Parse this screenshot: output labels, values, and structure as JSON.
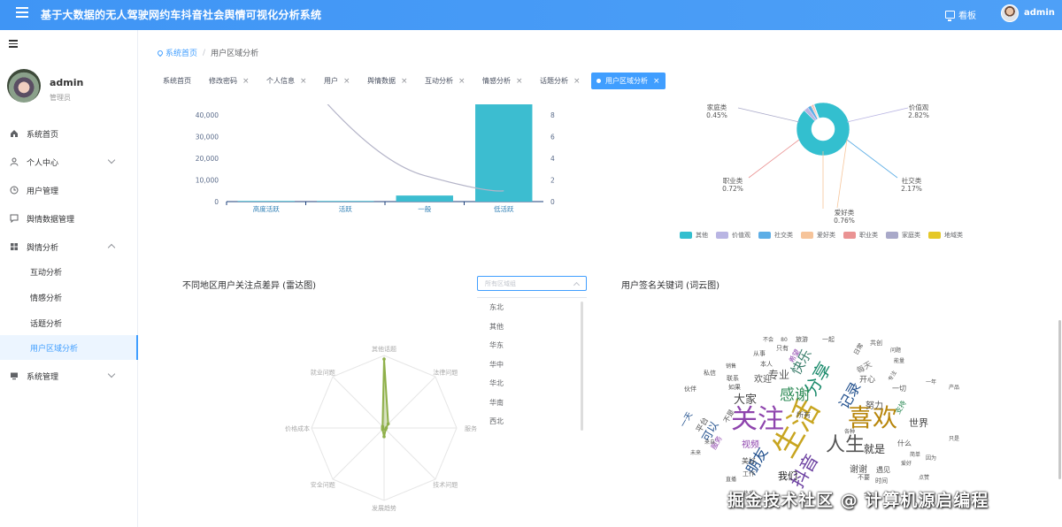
{
  "header": {
    "title": "基于大数据的无人驾驶网约车抖音社会舆情可视化分析系统",
    "board_label": "看板",
    "username": "admin"
  },
  "sidebar": {
    "user": {
      "name": "admin",
      "role": "管理员"
    },
    "items": [
      {
        "label": "系统首页",
        "icon": "home-icon"
      },
      {
        "label": "个人中心",
        "icon": "user-icon",
        "expandable": true
      },
      {
        "label": "用户管理",
        "icon": "clock-icon"
      },
      {
        "label": "舆情数据管理",
        "icon": "chat-icon"
      },
      {
        "label": "舆情分析",
        "icon": "grid-icon",
        "expanded": true,
        "children": [
          "互动分析",
          "情感分析",
          "话题分析",
          "用户区域分析"
        ]
      },
      {
        "label": "系统管理",
        "icon": "monitor-icon",
        "expandable": true
      }
    ],
    "active_child": "用户区域分析"
  },
  "breadcrumb": {
    "home": "系统首页",
    "current": "用户区域分析"
  },
  "tabs": [
    "系统首页",
    "修改密码",
    "个人信息",
    "用户",
    "舆情数据",
    "互动分析",
    "情感分析",
    "话题分析",
    "用户区域分析"
  ],
  "active_tab": "用户区域分析",
  "panels": {
    "radar_title": "不同地区用户关注点差异 (雷达图)",
    "region_select_placeholder": "所有区域组",
    "region_options": [
      "东北",
      "其他",
      "华东",
      "华中",
      "华北",
      "华南",
      "西北",
      "西南"
    ],
    "wordcloud_title": "用户签名关键词 (词云图)"
  },
  "chart_data": [
    {
      "type": "bar",
      "categories": [
        "高度活跃",
        "活跃",
        "一般",
        "低活跃"
      ],
      "series": [
        {
          "type": "bar",
          "values": [
            300,
            300,
            2800,
            45000
          ],
          "color": "#3cbdd0"
        },
        {
          "type": "line",
          "values": [
            16,
            10,
            4,
            1
          ],
          "axis": "right",
          "color": "#b4b4c8"
        }
      ],
      "ylim": [
        0,
        40000
      ],
      "yticks": [
        "0",
        "10,000",
        "20,000",
        "30,000",
        "40,000"
      ],
      "y2ticks": [
        "0",
        "2",
        "4",
        "6",
        "8"
      ]
    },
    {
      "type": "pie",
      "slices": [
        {
          "name": "其他",
          "value": 93.0,
          "color": "#33bfcf"
        },
        {
          "name": "价值观",
          "value": 2.82,
          "color": "#b9b5e3"
        },
        {
          "name": "社交类",
          "value": 2.17,
          "color": "#5daee6"
        },
        {
          "name": "爱好类",
          "value": 0.76,
          "color": "#f6c49a"
        },
        {
          "name": "职业类",
          "value": 0.72,
          "color": "#ea9393"
        },
        {
          "name": "家庭类",
          "value": 0.45,
          "color": "#a9a9c9"
        },
        {
          "name": "地域类",
          "value": 0.08,
          "color": "#e5c828"
        }
      ],
      "labels": [
        {
          "name": "家庭类",
          "pct": "0.45%"
        },
        {
          "name": "价值观",
          "pct": "2.82%"
        },
        {
          "name": "职业类",
          "pct": "0.72%"
        },
        {
          "name": "社交类",
          "pct": "2.17%"
        },
        {
          "name": "爱好类",
          "pct": "0.76%"
        }
      ]
    },
    {
      "type": "radar",
      "indicators": [
        "其他话题",
        "法律问题",
        "服务",
        "技术问题",
        "发展趋势",
        "安全问题",
        "价格成本",
        "就业问题"
      ],
      "series": [
        {
          "values": [
            95,
            8,
            3,
            3,
            12,
            3,
            2,
            3
          ],
          "color": "#8fb04a"
        }
      ]
    },
    {
      "type": "wordcloud",
      "words": [
        {
          "t": "生活",
          "s": 34,
          "c": "#c8a520"
        },
        {
          "t": "关注",
          "s": 30,
          "c": "#8e44ad"
        },
        {
          "t": "喜欢",
          "s": 28,
          "c": "#b8860b"
        },
        {
          "t": "人生",
          "s": 22,
          "c": "#555"
        },
        {
          "t": "分享",
          "s": 20,
          "c": "#1a8a6b"
        },
        {
          "t": "感谢",
          "s": 17,
          "c": "#2e8b57"
        },
        {
          "t": "抖音",
          "s": 20,
          "c": "#6b3fa0"
        },
        {
          "t": "朋友",
          "s": 16,
          "c": "#1f4e8c"
        },
        {
          "t": "记录",
          "s": 16,
          "c": "#1f4e8c"
        },
        {
          "t": "快乐",
          "s": 15,
          "c": "#3a7d6b"
        },
        {
          "t": "专业",
          "s": 12,
          "c": "#555"
        },
        {
          "t": "大家",
          "s": 13,
          "c": "#444"
        },
        {
          "t": "可以",
          "s": 12,
          "c": "#1f4e8c"
        },
        {
          "t": "就是",
          "s": 12,
          "c": "#333"
        },
        {
          "t": "努力",
          "s": 10,
          "c": "#555"
        },
        {
          "t": "世界",
          "s": 11,
          "c": "#444"
        },
        {
          "t": "谢谢",
          "s": 10,
          "c": "#555"
        },
        {
          "t": "视频",
          "s": 10,
          "c": "#8e44ad"
        },
        {
          "t": "欢迎",
          "s": 10,
          "c": "#555"
        },
        {
          "t": "我们",
          "s": 11,
          "c": "#222"
        },
        {
          "t": "开心",
          "s": 9,
          "c": "#555"
        },
        {
          "t": "每天",
          "s": 9,
          "c": "#777"
        },
        {
          "t": "所有",
          "s": 8,
          "c": "#555"
        },
        {
          "t": "一切",
          "s": 8,
          "c": "#555"
        },
        {
          "t": "支持",
          "s": 8,
          "c": "#2e8b57"
        },
        {
          "t": "遇见",
          "s": 8,
          "c": "#555"
        },
        {
          "t": "美好",
          "s": 8,
          "c": "#555"
        },
        {
          "t": "平台",
          "s": 9,
          "c": "#555"
        },
        {
          "t": "服务",
          "s": 8,
          "c": "#8e44ad"
        },
        {
          "t": "希望",
          "s": 8,
          "c": "#8e44ad"
        },
        {
          "t": "时间",
          "s": 7,
          "c": "#555"
        },
        {
          "t": "不要",
          "s": 7,
          "c": "#555"
        },
        {
          "t": "什么",
          "s": 8,
          "c": "#555"
        },
        {
          "t": "工作",
          "s": 7,
          "c": "#555"
        },
        {
          "t": "伙伴",
          "s": 7,
          "c": "#555"
        },
        {
          "t": "不是",
          "s": 8,
          "c": "#555"
        },
        {
          "t": "一天",
          "s": 9,
          "c": "#1f4e8c"
        },
        {
          "t": "本人",
          "s": 7,
          "c": "#555"
        },
        {
          "t": "如果",
          "s": 7,
          "c": "#555"
        },
        {
          "t": "日常",
          "s": 7,
          "c": "#555"
        },
        {
          "t": "旅游",
          "s": 7,
          "c": "#555"
        },
        {
          "t": "一起",
          "s": 7,
          "c": "#555"
        },
        {
          "t": "共创",
          "s": 7,
          "c": "#555"
        },
        {
          "t": "从事",
          "s": 7,
          "c": "#555"
        },
        {
          "t": "只有",
          "s": 7,
          "c": "#555"
        },
        {
          "t": "私信",
          "s": 7,
          "c": "#555"
        },
        {
          "t": "联系",
          "s": 7,
          "c": "#555"
        },
        {
          "t": "销售",
          "s": 6,
          "c": "#555"
        },
        {
          "t": "不会",
          "s": 6,
          "c": "#555"
        },
        {
          "t": "来自",
          "s": 6,
          "c": "#555"
        },
        {
          "t": "未来",
          "s": 6,
          "c": "#555"
        },
        {
          "t": "因为",
          "s": 6,
          "c": "#555"
        },
        {
          "t": "直播",
          "s": 6,
          "c": "#555"
        },
        {
          "t": "热爱",
          "s": 6,
          "c": "#555"
        },
        {
          "t": "只是",
          "s": 6,
          "c": "#555"
        },
        {
          "t": "产品",
          "s": 6,
          "c": "#555"
        },
        {
          "t": "一年",
          "s": 6,
          "c": "#555"
        },
        {
          "t": "简单",
          "s": 6,
          "c": "#555"
        },
        {
          "t": "问题",
          "s": 6,
          "c": "#555"
        },
        {
          "t": "能量",
          "s": 6,
          "c": "#555"
        },
        {
          "t": "80",
          "s": 6,
          "c": "#555"
        },
        {
          "t": "各种",
          "s": 6,
          "c": "#555"
        },
        {
          "t": "专注",
          "s": 6,
          "c": "#555"
        },
        {
          "t": "点赞",
          "s": 6,
          "c": "#555"
        },
        {
          "t": "爱好",
          "s": 6,
          "c": "#555"
        },
        {
          "t": "学习",
          "s": 6,
          "c": "#555"
        }
      ]
    }
  ],
  "watermark": "掘金技术社区 @ 计算机源启编程"
}
